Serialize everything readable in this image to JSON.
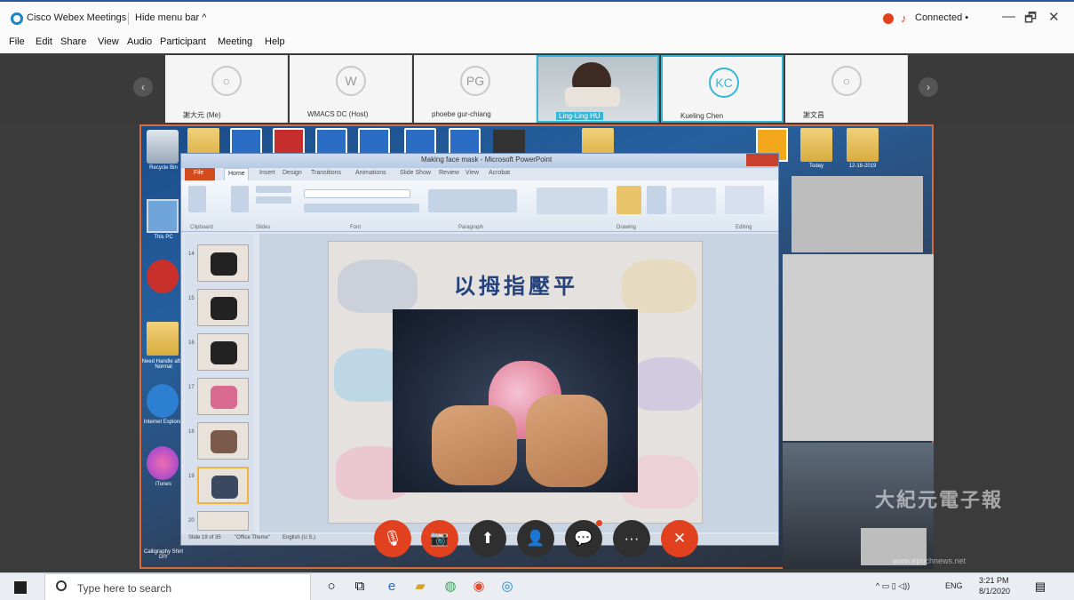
{
  "titlebar": {
    "title": "Cisco Webex Meetings",
    "hide_menu": "Hide menu bar ^",
    "status": "Connected •",
    "minimize": "—",
    "restore": "🗗",
    "close": "✕"
  },
  "menu": [
    "File",
    "Edit",
    "Share",
    "View",
    "Audio",
    "Participant",
    "Meeting",
    "Help"
  ],
  "participants": [
    {
      "initials": "",
      "name": "謝大元 (Me)"
    },
    {
      "initials": "W",
      "name": "WMACS DC (Host)"
    },
    {
      "initials": "PG",
      "name": "phoebe gur-chiang"
    },
    {
      "initials": "",
      "name": "Ling-Ling HU"
    },
    {
      "initials": "KC",
      "name": "Kueling Chen"
    },
    {
      "initials": "",
      "name": "謝文昌"
    }
  ],
  "ppt": {
    "title": "Making face mask - Microsoft PowerPoint",
    "tabs": [
      "File",
      "Home",
      "Insert",
      "Design",
      "Transitions",
      "Animations",
      "Slide Show",
      "Review",
      "View",
      "Acrobat"
    ],
    "groups": [
      "Clipboard",
      "Slides",
      "Font",
      "Paragraph",
      "Drawing",
      "Editing"
    ],
    "thumb_numbers": [
      "14",
      "15",
      "16",
      "17",
      "18",
      "19",
      "20"
    ],
    "slide_title": "以拇指壓平",
    "status": [
      "Slide 19 of 35",
      "\"Office Theme\"",
      "English (U.S.)"
    ]
  },
  "desktop": {
    "labels": [
      "Recycle Bin",
      "This PC",
      "Calligraphy Shirt DIY",
      "Need Handle after Normal",
      "Internet Explorer",
      "iTunes",
      "Today",
      "12-18-2019"
    ]
  },
  "controls": {
    "mute": "🎙",
    "video": "📷",
    "share": "⬆",
    "participants": "👤",
    "chat": "💬",
    "more": "···",
    "leave": "✕"
  },
  "watermark": {
    "text": "大紀元電子報",
    "url": "www.epochnews.net"
  },
  "taskbar": {
    "search_placeholder": "Type here to search",
    "lang": "ENG",
    "time": "3:21 PM",
    "date": "8/1/2020"
  },
  "colors": {
    "webex_blue": "#1a84c6",
    "accent_red": "#e2411f",
    "active_tile": "#36b6d6",
    "ppt_orange": "#d44b1d"
  }
}
